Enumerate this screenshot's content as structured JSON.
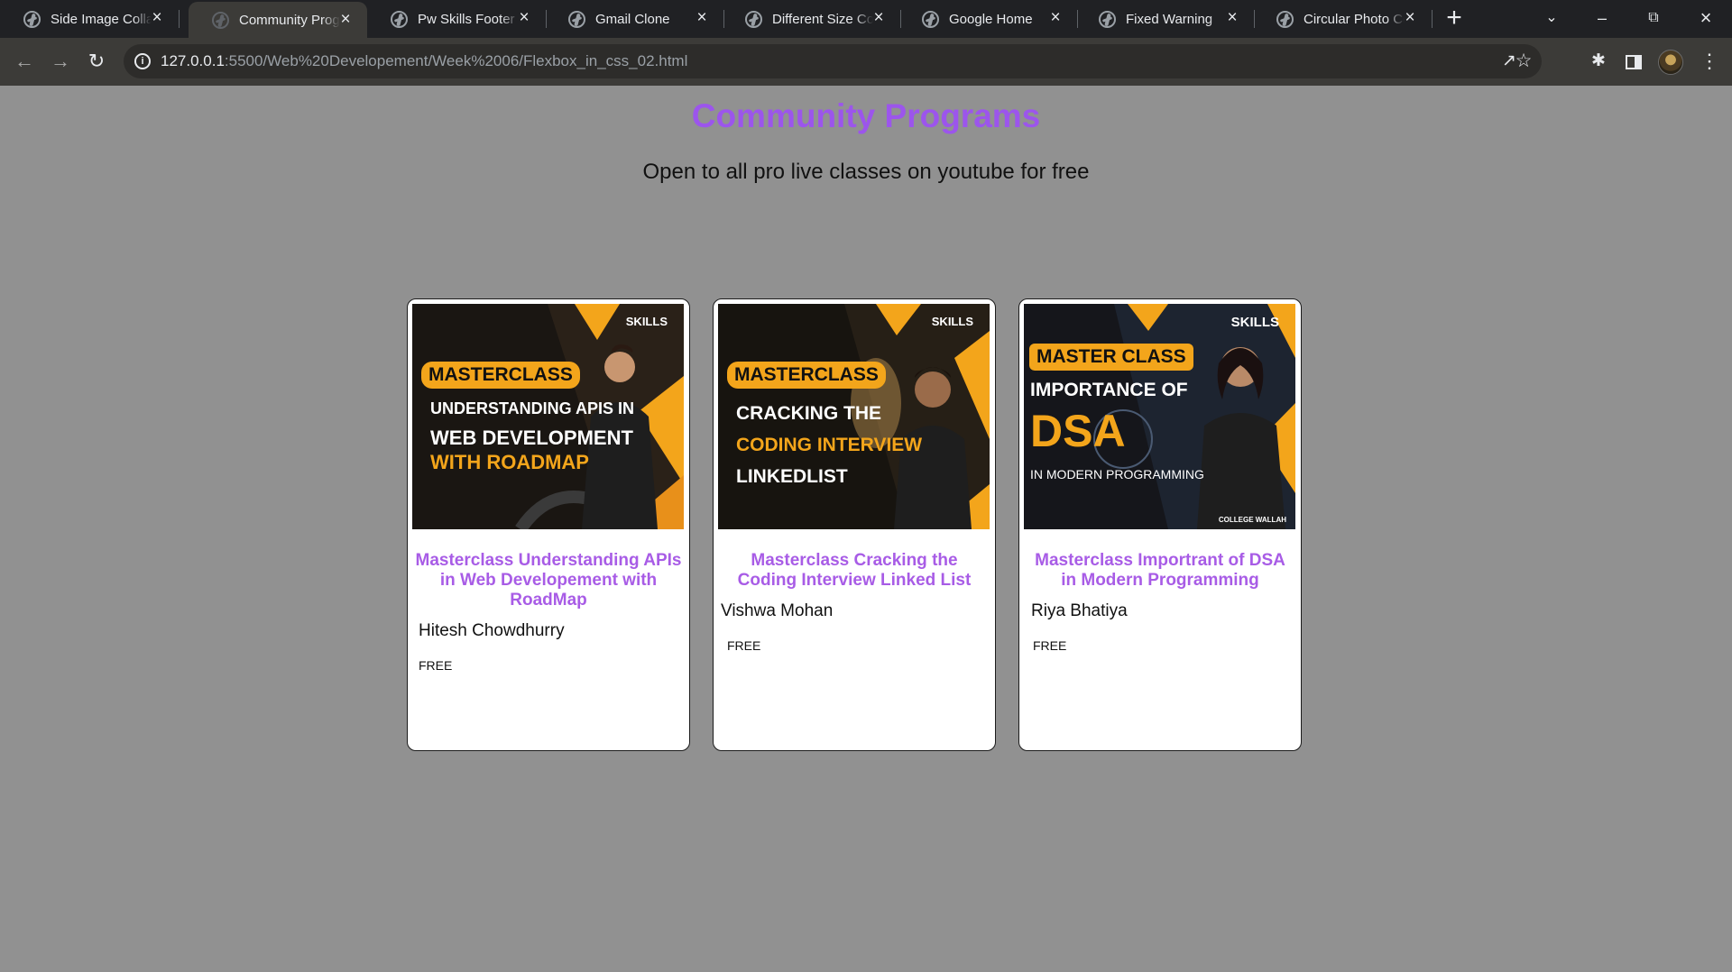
{
  "browser": {
    "tabs": [
      {
        "title": "Side Image Colla",
        "active": false
      },
      {
        "title": "Community Prog",
        "active": true
      },
      {
        "title": "Pw Skills Footer",
        "active": false
      },
      {
        "title": "Gmail Clone",
        "active": false
      },
      {
        "title": "Different Size Co",
        "active": false
      },
      {
        "title": "Google Home",
        "active": false
      },
      {
        "title": "Fixed Warning",
        "active": false
      },
      {
        "title": "Circular Photo Co",
        "active": false
      }
    ],
    "url_host": "127.0.0.1",
    "url_path": ":5500/Web%20Developement/Week%2006/Flexbox_in_css_02.html",
    "icons": {
      "back": "back-arrow-icon",
      "forward": "forward-arrow-icon",
      "reload": "reload-icon",
      "site_info": "info-icon",
      "share": "share-icon",
      "bookmark": "star-icon",
      "extensions": "puzzle-icon",
      "side_panel": "side-panel-icon",
      "menu": "kebab-menu-icon"
    }
  },
  "page": {
    "title": "Community Programs",
    "subtitle": "Open to all pro live classes on youtube for free",
    "title_color": "#9c55ec",
    "card_title_color": "#a85ce6",
    "background_color": "#919191"
  },
  "cards": [
    {
      "title": "Masterclass Understanding APIs in Web Developement with RoadMap",
      "author": "Hitesh Chowdhurry",
      "price": "FREE",
      "thumbnail": {
        "brand": "SKILLS",
        "badge": "MASTERCLASS",
        "lines": [
          "UNDERSTANDING APIS IN",
          "WEB DEVELOPMENT",
          "WITH ROADMAP"
        ]
      }
    },
    {
      "title": "Masterclass Cracking the Coding Interview Linked List",
      "author": "Vishwa Mohan",
      "price": "FREE",
      "thumbnail": {
        "brand": "SKILLS",
        "badge": "MASTERCLASS",
        "lines": [
          "CRACKING THE",
          "CODING INTERVIEW",
          "LINKEDLIST"
        ]
      }
    },
    {
      "title": "Masterclass Importrant of DSA in Modern Programming",
      "author": "Riya Bhatiya",
      "price": "FREE",
      "thumbnail": {
        "brand": "SKILLS",
        "badge": "MASTER CLASS",
        "lines": [
          "IMPORTANCE OF",
          "DSA",
          "IN MODERN PROGRAMMING"
        ],
        "footer": "COLLEGE WALLAH"
      }
    }
  ]
}
